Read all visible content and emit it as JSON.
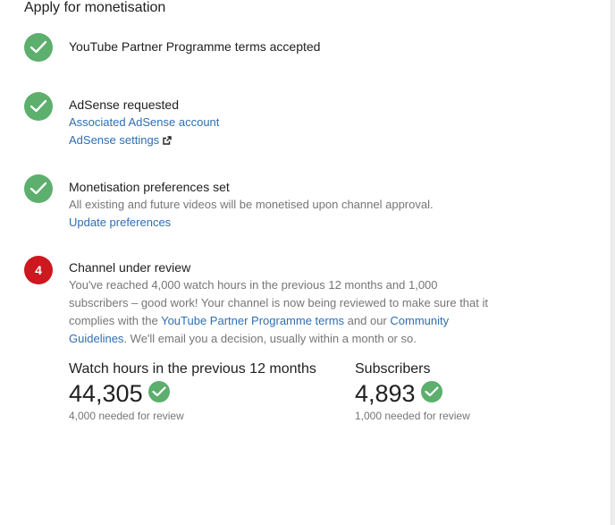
{
  "page": {
    "title": "Apply for monetisation"
  },
  "colors": {
    "done_green": "#5caf6c",
    "pending_red": "#cc181e",
    "link_blue": "#2f6eb3",
    "secondary_text": "#767676"
  },
  "steps": [
    {
      "status": "done",
      "icon": "check-icon",
      "title": "YouTube Partner Programme terms accepted"
    },
    {
      "status": "done",
      "icon": "check-icon",
      "title": "AdSense requested",
      "links": {
        "associated_account": "Associated AdSense account",
        "settings": "AdSense settings"
      },
      "settings_icon": "external-link-icon"
    },
    {
      "status": "done",
      "icon": "check-icon",
      "title": "Monetisation preferences set",
      "description": "All existing and future videos will be monetised upon channel approval.",
      "link": "Update preferences"
    },
    {
      "status": "in-progress",
      "number": "4",
      "title": "Channel under review",
      "description": {
        "part1": "You've reached 4,000 watch hours in the previous 12 months and 1,000 subscribers – good work! Your channel is now being reviewed to make sure that it complies with the ",
        "link1": "YouTube Partner Programme terms",
        "part2": " and our ",
        "link2": "Community Guidelines",
        "part3": ". We'll email you a decision, usually within a month or so."
      },
      "stats": {
        "watch_hours": {
          "label": "Watch hours in the previous 12 months",
          "value": "44,305",
          "requirement": "4,000 needed for review",
          "icon": "check-icon"
        },
        "subscribers": {
          "label": "Subscribers",
          "value": "4,893",
          "requirement": "1,000 needed for review",
          "icon": "check-icon"
        }
      }
    }
  ]
}
